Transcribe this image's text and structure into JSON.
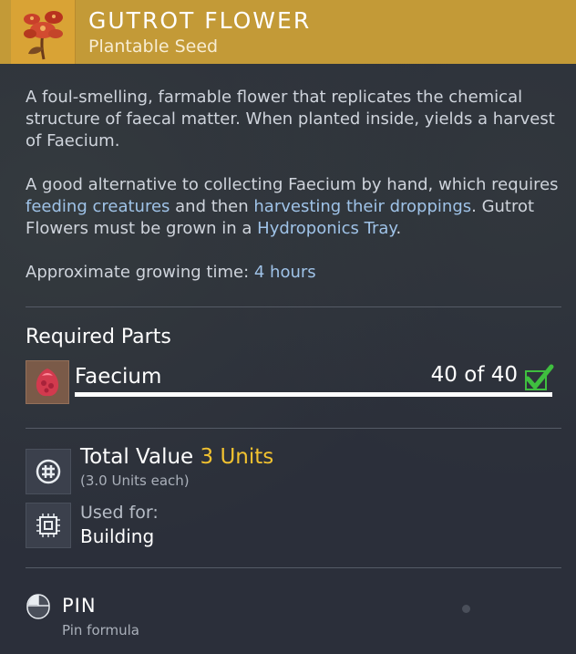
{
  "item": {
    "name": "GUTROT FLOWER",
    "category": "Plantable Seed",
    "icon": "gutrot-flower-icon"
  },
  "description": {
    "p1": "A foul-smelling, farmable flower that replicates the chemical structure of faecal matter. When planted inside, yields a harvest of Faecium.",
    "p2": {
      "t1": "A good alternative to collecting Faecium by hand, which requires ",
      "link1": "feeding creatures",
      "t2": " and then ",
      "link2": "harvesting their droppings",
      "t3": ". Gutrot Flowers must be grown in a ",
      "link3": "Hydroponics Tray",
      "t4": "."
    },
    "p3": {
      "label": "Approximate growing time: ",
      "value": "4 hours"
    }
  },
  "required_parts": {
    "title": "Required Parts",
    "items": [
      {
        "name": "Faecium",
        "count": "40 of 40",
        "have": 40,
        "need": 40,
        "complete": true,
        "icon": "faecium-icon"
      }
    ]
  },
  "value": {
    "label": "Total Value",
    "units": "3 Units",
    "each": "(3.0 Units each)",
    "icon": "units-currency-icon"
  },
  "usage": {
    "label": "Used for:",
    "value": "Building",
    "icon": "building-chip-icon"
  },
  "pin": {
    "label": "PIN",
    "sub": "Pin formula",
    "icon": "mouse-icon"
  },
  "colors": {
    "header": "#c39a37",
    "background": "#2b2f3a",
    "link": "#9fc3e8",
    "units": "#f2c230",
    "check": "#3fbf3f"
  }
}
